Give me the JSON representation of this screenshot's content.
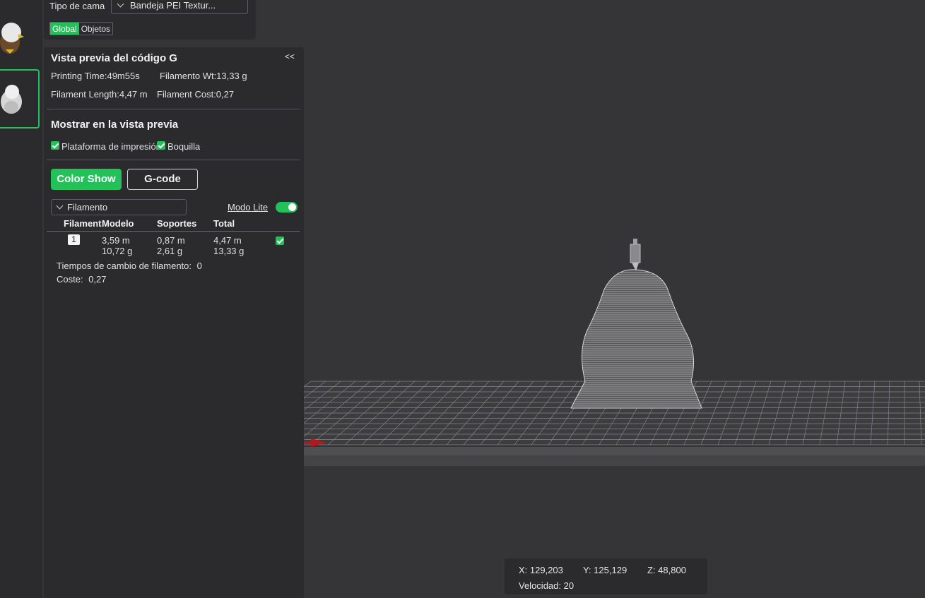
{
  "top_settings": {
    "bed_type_label": "Tipo de cama",
    "bed_type_value": "Bandeja PEI Textur...",
    "scope_tabs": [
      "Global",
      "Objetos"
    ]
  },
  "preview": {
    "title": "Vista previa del código G",
    "collapse_label": "<<",
    "printing_time": "Printing Time:49m55s",
    "filament_weight": "Filamento Wt:13,33 g",
    "filament_length": "Filament Length:4,47 m",
    "filament_cost": "Filament Cost:0,27",
    "show_section_title": "Mostrar en la vista previa",
    "show_options": [
      "Plataforma de impresión",
      "Boquilla"
    ],
    "view_buttons": [
      "Color Show",
      "G-code"
    ],
    "view_type": "Filamento",
    "lite_mode_label": "Modo Lite",
    "lite_mode_on": true
  },
  "filament_table": {
    "headers": [
      "Filamento",
      "Modelo",
      "Soportes",
      "Total"
    ],
    "rows": [
      {
        "index": "1",
        "model_length": "3,59 m",
        "model_weight": "10,72 g",
        "support_length": "0,87 m",
        "support_weight": "2,61 g",
        "total_length": "4,47 m",
        "total_weight": "13,33 g",
        "visible": true
      }
    ],
    "change_times_label": "Tiempos de cambio de filamento:",
    "change_times_value": "0",
    "cost_label": "Coste:",
    "cost_value": "0,27"
  },
  "coords": {
    "x": "X: 129,203",
    "y": "Y: 125,129",
    "z": "Z: 48,800",
    "speed": "Velocidad: 20"
  },
  "colors": {
    "accent": "#22c15a",
    "background": "#353537",
    "panel": "#2b2b2d"
  }
}
